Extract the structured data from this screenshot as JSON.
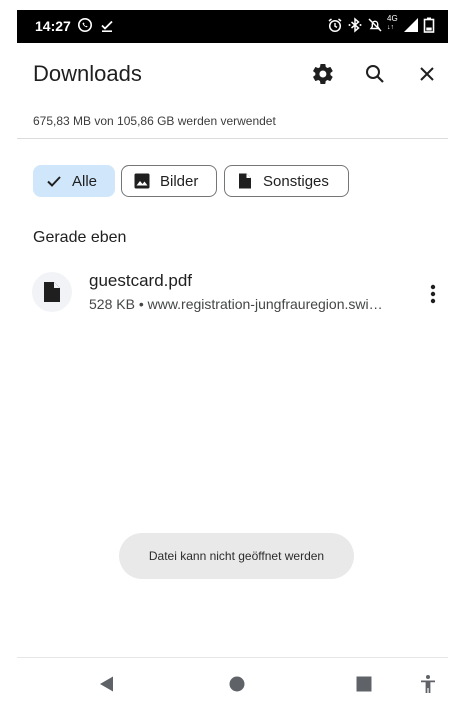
{
  "status_bar": {
    "time": "14:27",
    "left_icons": [
      "whatsapp-icon",
      "download-done-icon"
    ],
    "right_icons": [
      "alarm-icon",
      "bluetooth-icon",
      "mute-icon",
      "network-4g-icon",
      "signal-icon",
      "battery-icon"
    ],
    "network_label": "4G"
  },
  "appbar": {
    "title": "Downloads",
    "actions": [
      "gear-icon",
      "search-icon",
      "close-icon"
    ]
  },
  "storage": {
    "text": "675,83 MB von 105,86 GB werden verwendet"
  },
  "filters": {
    "chips": [
      {
        "label": "Alle",
        "icon": "check-icon",
        "selected": true
      },
      {
        "label": "Bilder",
        "icon": "image-icon",
        "selected": false
      },
      {
        "label": "Sonstiges",
        "icon": "file-icon",
        "selected": false
      }
    ]
  },
  "section": {
    "title": "Gerade eben"
  },
  "files": [
    {
      "name": "guestcard.pdf",
      "meta": "528 KB • www.registration-jungfrauregion.swi…",
      "icon": "file-icon"
    }
  ],
  "toast": {
    "text": "Datei kann nicht geöffnet werden"
  },
  "navbar": {
    "buttons": [
      "back-icon",
      "home-icon",
      "recents-icon",
      "accessibility-icon"
    ]
  },
  "colors": {
    "status_bar": "#000000",
    "chip_selected": "#cfe6fb",
    "chip_border": "#747775",
    "toast_bg": "#e9e9e9",
    "text_primary": "#1f1f1f"
  }
}
